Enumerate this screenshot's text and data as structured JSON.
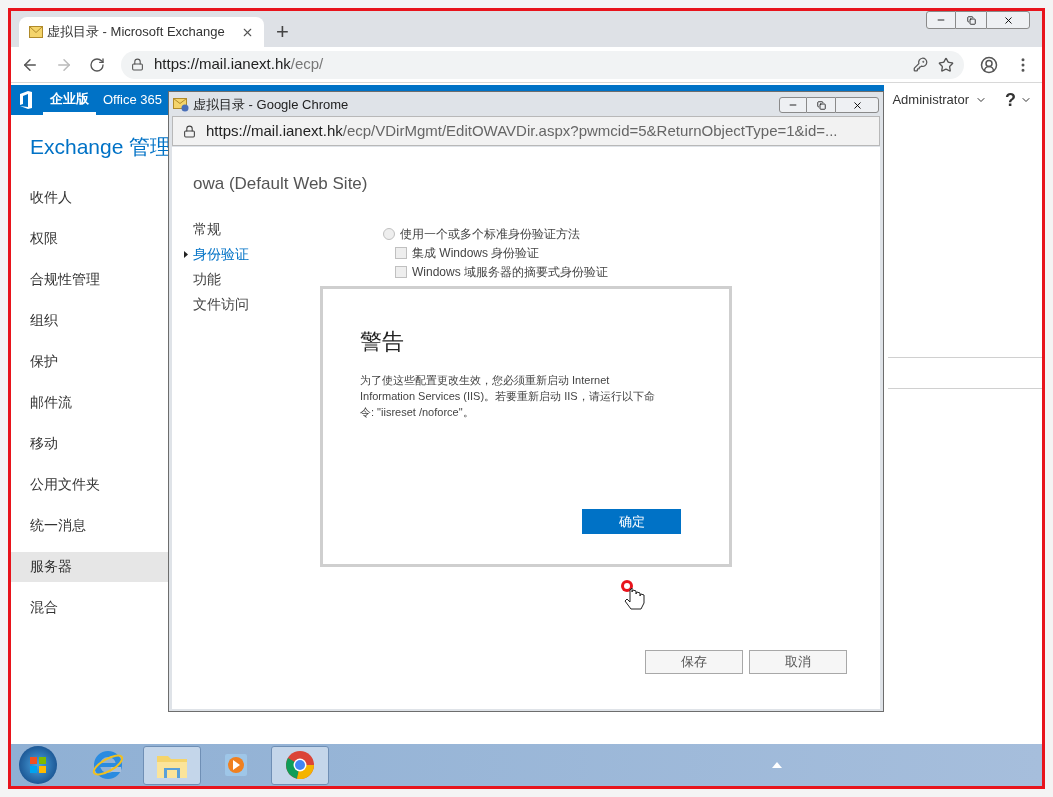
{
  "browser": {
    "tab_title": "虚拟目录 - Microsoft Exchange",
    "new_tab": "+",
    "url_host": "https://mail.ianext.hk",
    "url_path": "/ecp/"
  },
  "exchange": {
    "nav": [
      {
        "label": "企业版",
        "selected": true
      },
      {
        "label": "Office 365",
        "selected": false
      }
    ],
    "user": "Administrator",
    "help": "?",
    "title": "Exchange 管理",
    "sidebar": [
      {
        "label": "收件人",
        "selected": false
      },
      {
        "label": "权限",
        "selected": false
      },
      {
        "label": "合规性管理",
        "selected": false
      },
      {
        "label": "组织",
        "selected": false
      },
      {
        "label": "保护",
        "selected": false
      },
      {
        "label": "邮件流",
        "selected": false
      },
      {
        "label": "移动",
        "selected": false
      },
      {
        "label": "公用文件夹",
        "selected": false
      },
      {
        "label": "统一消息",
        "selected": false
      },
      {
        "label": "服务器",
        "selected": true
      },
      {
        "label": "混合",
        "selected": false
      }
    ]
  },
  "popup": {
    "title": "虚拟目录 - Google Chrome",
    "url_host": "https://mail.ianext.hk",
    "url_path": "/ecp/VDirMgmt/EditOWAVDir.aspx?pwmcid=5&ReturnObjectType=1&id=...",
    "heading": "owa (Default Web Site)",
    "sections": [
      {
        "label": "常规",
        "selected": false
      },
      {
        "label": "身份验证",
        "selected": true
      },
      {
        "label": "功能",
        "selected": false
      },
      {
        "label": "文件访问",
        "selected": false
      }
    ],
    "options": [
      {
        "kind": "radio",
        "label": "使用一个或多个标准身份验证方法",
        "checked": false
      },
      {
        "kind": "checkbox",
        "label": "集成 Windows 身份验证",
        "checked": false
      },
      {
        "kind": "checkbox",
        "label": "Windows 域服务器的摘要式身份验证",
        "checked": false
      }
    ],
    "buttons": [
      "保存",
      "取消"
    ]
  },
  "dialog": {
    "title": "警告",
    "message": "为了使这些配置更改生效，您必须重新启动 Internet Information Services (IIS)。若要重新启动 IIS，请运行以下命令: \"iisreset /noforce\"。",
    "button": "确定"
  },
  "taskbar": {
    "apps": [
      {
        "kind": "ie",
        "selected": false
      },
      {
        "kind": "explorer",
        "selected": true
      },
      {
        "kind": "media",
        "selected": false
      },
      {
        "kind": "chrome",
        "selected": true
      }
    ]
  }
}
